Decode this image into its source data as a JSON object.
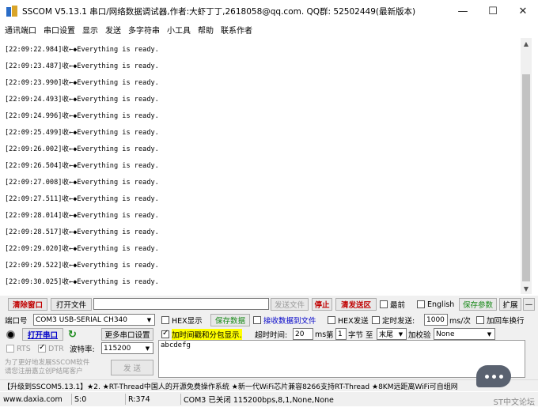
{
  "window": {
    "title": "SSCOM V5.13.1 串口/网络数据调试器,作者:大虾丁丁,2618058@qq.com. QQ群: 52502449(最新版本)",
    "minimize": "—",
    "maximize": "☐",
    "close": "✕"
  },
  "menu": [
    "通讯端口",
    "串口设置",
    "显示",
    "发送",
    "多字符串",
    "小工具",
    "帮助",
    "联系作者"
  ],
  "log": {
    "lines": [
      "[22:09:22.984]收←◆Everything is ready.",
      "[22:09:23.487]收←◆Everything is ready.",
      "[22:09:23.990]收←◆Everything is ready.",
      "[22:09:24.493]收←◆Everything is ready.",
      "[22:09:24.996]收←◆Everything is ready.",
      "[22:09:25.499]收←◆Everything is ready.",
      "[22:09:26.002]收←◆Everything is ready.",
      "[22:09:26.504]收←◆Everything is ready.",
      "[22:09:27.008]收←◆Everything is ready.",
      "[22:09:27.511]收←◆Everything is ready.",
      "[22:09:28.014]收←◆Everything is ready.",
      "[22:09:28.517]收←◆Everything is ready.",
      "[22:09:29.020]收←◆Everything is ready.",
      "[22:09:29.522]收←◆Everything is ready.",
      "[22:09:30.025]收←◆Everything is ready."
    ]
  },
  "toolbar": {
    "clear_window": "清除窗口",
    "open_file": "打开文件",
    "send_file": "发送文件",
    "stop": "停止",
    "clear_send": "清发送区",
    "topmost": "最前",
    "english": "English",
    "save_params": "保存参数",
    "expand": "扩展",
    "dash": "—"
  },
  "port_row": {
    "port_label": "端口号",
    "port_value": "COM3 USB-SERIAL CH340",
    "hex_display": "HEX显示",
    "save_data": "保存数据",
    "recv_to_file": "接收数据到文件",
    "hex_send": "HEX发送",
    "timed_send": "定时发送:",
    "interval": "1000",
    "interval_unit": "ms/次",
    "add_crlf": "加回车换行"
  },
  "open_row": {
    "open_port": "打开串口",
    "more_settings": "更多串口设置",
    "timestamp": "加时间戳和分包显示.",
    "timeout_label": "超时时间:",
    "timeout_value": "20",
    "ms": "ms",
    "page_label": "第",
    "page_value": "1",
    "byte_label": "字节 至",
    "end_value": "末尾",
    "checksum_label": "加校验",
    "checksum_value": "None"
  },
  "rts_row": {
    "rts": "RTS",
    "dtr": "DTR",
    "baud_label": "波特率:",
    "baud_value": "115200"
  },
  "send": {
    "text": "abcdefg",
    "promo": "为了更好地发展SSCOM软件\n请您注册嘉立创P结尾客户",
    "send_button": "发 送"
  },
  "marquee": "【升级到SSCOM5.13.1】★2. ★RT-Thread中国人的开源免费操作系统 ★新一代WiFi芯片兼容8266支持RT-Thread ★8KM远距离WiFi可自组网",
  "status": {
    "site": "www.daxia.com",
    "s": "S:0",
    "r": "R:374",
    "port_status": "COM3 已关闭  115200bps,8,1,None,None"
  },
  "watermark": "ST中文论坛",
  "colors": {
    "accent_red": "#c00000",
    "accent_green": "#1a8a1a",
    "accent_blue": "#0000c8",
    "highlight_yellow": "#ffff00"
  }
}
